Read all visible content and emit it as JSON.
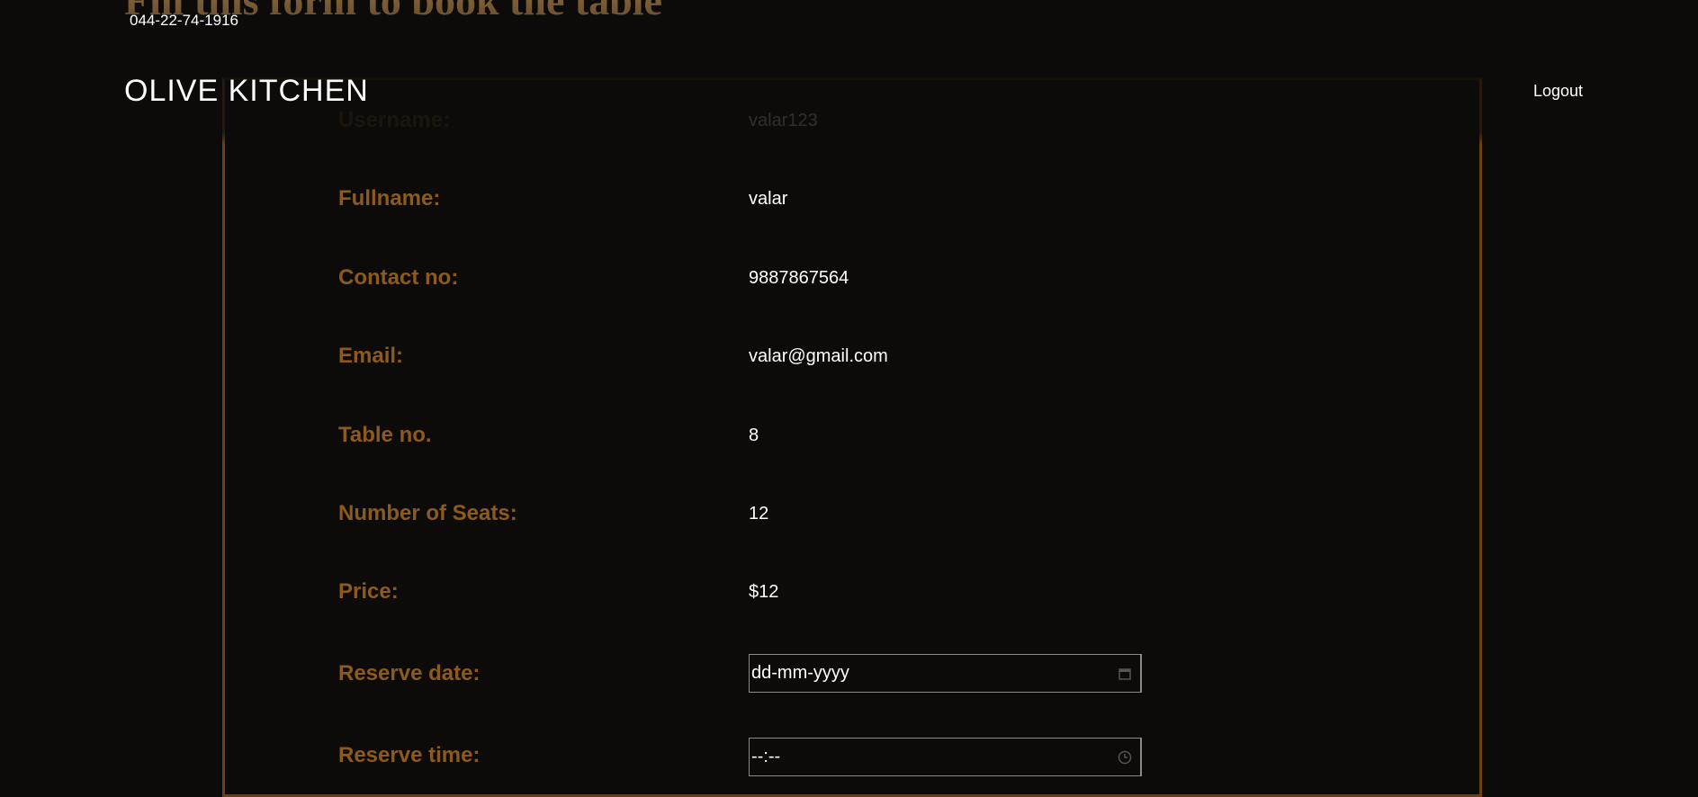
{
  "form": {
    "heading": "Fill this form to book the table",
    "fields": [
      {
        "label": "Username:",
        "value": "valar123"
      },
      {
        "label": "Fullname:",
        "value": "valar"
      },
      {
        "label": "Contact no:",
        "value": "9887867564"
      },
      {
        "label": "Email:",
        "value": "valar@gmail.com"
      },
      {
        "label": "Table no.",
        "value": "8"
      },
      {
        "label": "Number of Seats:",
        "value": "12"
      },
      {
        "label": "Price:",
        "value": "$12"
      }
    ],
    "reserve_date": {
      "label": "Reserve date:",
      "placeholder": "dd-mm-yyyy",
      "icon": "calendar-icon"
    },
    "reserve_time": {
      "label": "Reserve time:",
      "placeholder": "--:--",
      "icon": "clock-icon"
    }
  },
  "header": {
    "phone": "044-22-74-1916",
    "brand": "OLIVE KITCHEN",
    "logout_label": "Logout"
  },
  "colors": {
    "background": "#0c0b0a",
    "heading": "#b8894f",
    "label": "#8c5a1d",
    "border": "#6b3f0f"
  }
}
